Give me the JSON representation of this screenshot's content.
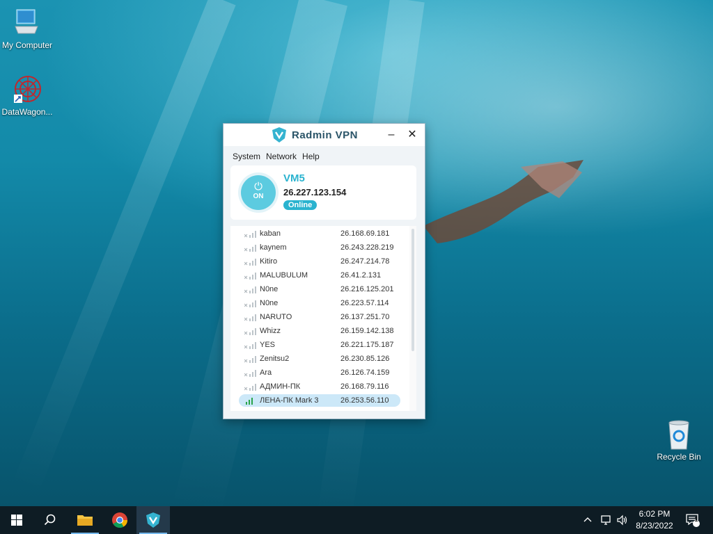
{
  "desktop": {
    "icons": [
      {
        "label": "My Computer",
        "icon": "computer-icon"
      },
      {
        "label": "DataWagon...",
        "icon": "datawagon-icon"
      },
      {
        "label": "Recycle Bin",
        "icon": "recycle-bin-icon"
      }
    ]
  },
  "window": {
    "brand": "Radmin VPN",
    "menu": [
      "System",
      "Network",
      "Help"
    ],
    "minimize_label": "–",
    "close_label": "✕",
    "status": {
      "power_symbol": "⏻",
      "power_label": "ON",
      "host": "VM5",
      "ip": "26.227.123.154",
      "state": "Online"
    },
    "peers": [
      {
        "name": "kaban",
        "ip": "26.168.69.181",
        "online": false
      },
      {
        "name": "kaynem",
        "ip": "26.243.228.219",
        "online": false
      },
      {
        "name": "Kitiro",
        "ip": "26.247.214.78",
        "online": false
      },
      {
        "name": "MALUBULUM",
        "ip": "26.41.2.131",
        "online": false
      },
      {
        "name": "N0ne",
        "ip": "26.216.125.201",
        "online": false
      },
      {
        "name": "N0ne",
        "ip": "26.223.57.114",
        "online": false
      },
      {
        "name": "NARUTO",
        "ip": "26.137.251.70",
        "online": false
      },
      {
        "name": "Whizz",
        "ip": "26.159.142.138",
        "online": false
      },
      {
        "name": "YES",
        "ip": "26.221.175.187",
        "online": false
      },
      {
        "name": "Zenitsu2",
        "ip": "26.230.85.126",
        "online": false
      },
      {
        "name": "Ara",
        "ip": "26.126.74.159",
        "online": false
      },
      {
        "name": "АДМИН-ПК",
        "ip": "26.168.79.116",
        "online": false
      },
      {
        "name": "ЛЕНА-ПК Mark 3",
        "ip": "26.253.56.110",
        "online": true,
        "selected": true
      }
    ]
  },
  "taskbar": {
    "items": [
      "start-button",
      "search-button",
      "file-explorer",
      "chrome",
      "radmin-vpn"
    ],
    "active": "radmin-vpn",
    "clock": {
      "time": "6:02 PM",
      "date": "8/23/2022"
    },
    "notification_count": "1"
  },
  "colors": {
    "accent": "#2ab3cf",
    "taskbar": "#0e1c24",
    "selection": "#cce8f8"
  }
}
